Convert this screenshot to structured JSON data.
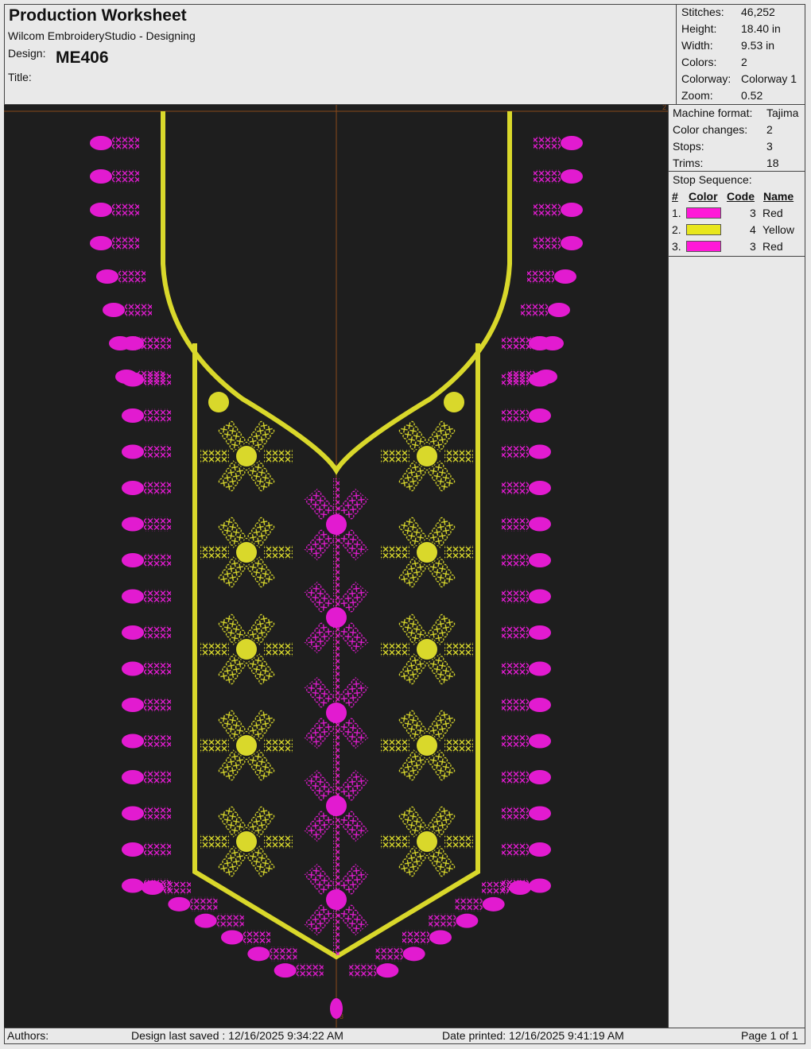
{
  "header": {
    "title": "Production Worksheet",
    "subtitle": "Wilcom EmbroideryStudio - Designing",
    "design_label": "Design:",
    "design_value": "ME406",
    "title_label": "Title:"
  },
  "stats": [
    {
      "label": "Stitches:",
      "value": "46,252"
    },
    {
      "label": "Height:",
      "value": "18.40 in"
    },
    {
      "label": "Width:",
      "value": "9.53 in"
    },
    {
      "label": "Colors:",
      "value": "2"
    },
    {
      "label": "Colorway:",
      "value": "Colorway 1"
    },
    {
      "label": "Zoom:",
      "value": "0.52"
    }
  ],
  "machine": [
    {
      "label": "Machine format:",
      "value": "Tajima"
    },
    {
      "label": "Color changes:",
      "value": "2"
    },
    {
      "label": "Stops:",
      "value": "3"
    },
    {
      "label": "Trims:",
      "value": "18"
    }
  ],
  "stop_sequence": {
    "label": "Stop Sequence:",
    "headers": {
      "num": "#",
      "color": "Color",
      "code": "Code",
      "name": "Name"
    },
    "rows": [
      {
        "num": "1.",
        "color": "#ff18d8",
        "code": "3",
        "name": "Red"
      },
      {
        "num": "2.",
        "color": "#e8e61c",
        "code": "4",
        "name": "Yellow"
      },
      {
        "num": "3.",
        "color": "#ff18d8",
        "code": "3",
        "name": "Red"
      }
    ]
  },
  "canvas": {
    "marker_top": "2",
    "marker_bottom": "3",
    "colors": {
      "magenta": "#e21bd0",
      "yellow": "#d9d82b",
      "background": "#1e1e1e"
    }
  },
  "footer": {
    "authors": "Authors:",
    "saved": "Design last saved : 12/16/2025 9:34:22 AM",
    "printed": "Date printed: 12/16/2025 9:41:19 AM",
    "page": "Page 1 of 1"
  }
}
